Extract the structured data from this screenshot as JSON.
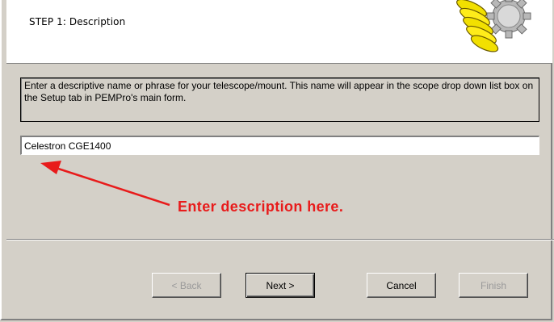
{
  "header": {
    "step_title": "STEP 1: Description"
  },
  "instructions": "Enter a descriptive name or phrase for your telescope/mount. This name will appear in the scope drop down list box on the Setup tab in PEMPro's main form.",
  "description_field": {
    "value": "Celestron CGE1400"
  },
  "annotation": {
    "text": "Enter description here.",
    "color": "#e81b1b"
  },
  "buttons": {
    "back": "< Back",
    "next": "Next >",
    "cancel": "Cancel",
    "finish": "Finish"
  },
  "icons": {
    "logo": "worm-gear-icon",
    "annotation_arrow": "red-arrow-icon"
  }
}
